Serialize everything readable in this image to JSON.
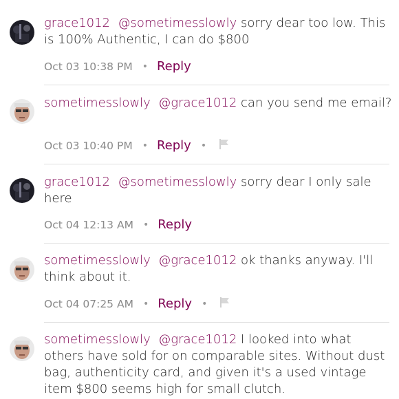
{
  "comments": [
    {
      "user": "grace1012",
      "mention": "@sometimesslowly",
      "message": "sorry dear too low. This is 100% Authentic,  I can do $800",
      "timestamp": "Oct 03 10:38 PM",
      "reply_label": "Reply",
      "has_flag": false,
      "avatar": "grace1012-avatar"
    },
    {
      "user": "sometimesslowly",
      "mention": "@grace1012",
      "message": "can you send me email?",
      "timestamp": "Oct 03 10:40 PM",
      "reply_label": "Reply",
      "has_flag": true,
      "avatar": "sometimesslowly-avatar"
    },
    {
      "user": "grace1012",
      "mention": "@sometimesslowly",
      "message": "sorry dear I only sale here",
      "timestamp": "Oct 04 12:13 AM",
      "reply_label": "Reply",
      "has_flag": false,
      "avatar": "grace1012-avatar"
    },
    {
      "user": "sometimesslowly",
      "mention": "@grace1012",
      "message": "ok thanks anyway. I'll think about it.",
      "timestamp": "Oct 04 07:25 AM",
      "reply_label": "Reply",
      "has_flag": true,
      "avatar": "sometimesslowly-avatar"
    },
    {
      "user": "sometimesslowly",
      "mention": "@grace1012",
      "message": "I looked into what others have sold for on comparable sites. Without dust bag, authenticity card, and given it's a used vintage item $800 seems high for small clutch.",
      "avatar": "sometimesslowly-avatar"
    }
  ],
  "colors": {
    "username": "#7f0353",
    "text": "#222222",
    "meta": "#8a8a8a",
    "divider": "#dedede"
  },
  "icons": {
    "separator": "dot",
    "flag": "flag-icon"
  }
}
